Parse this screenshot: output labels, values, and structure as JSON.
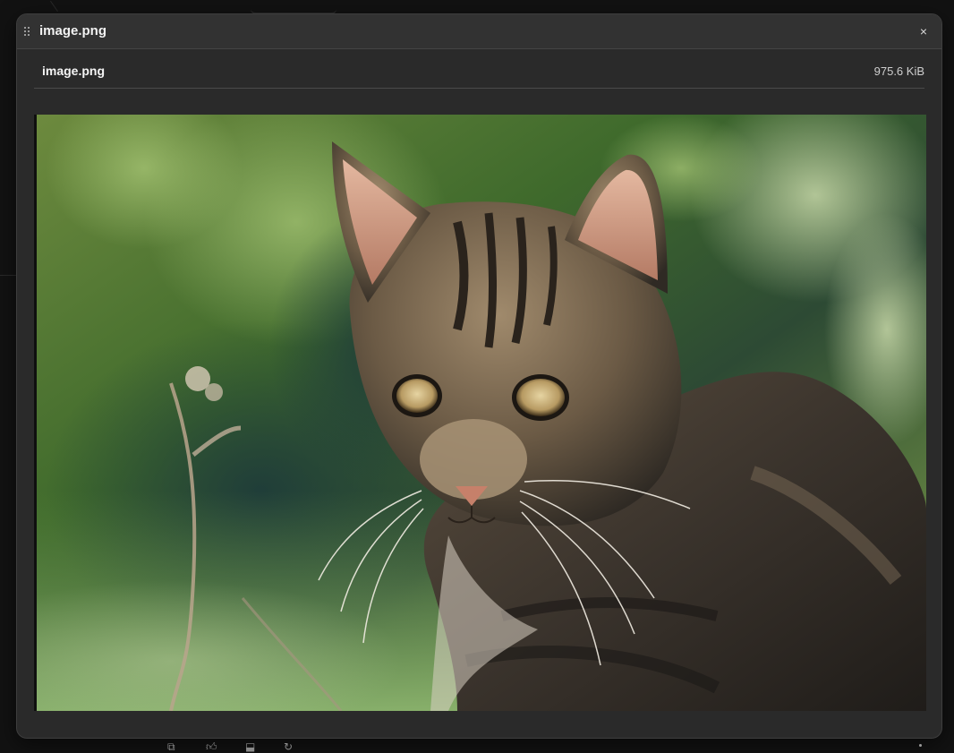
{
  "modal": {
    "title": "image.png",
    "close_label": "×"
  },
  "file": {
    "name": "image.png",
    "size": "975.6 KiB"
  },
  "preview": {
    "subject": "tabby cat photo"
  },
  "icons": {
    "drag": "drag-handle-icon",
    "close": "close-icon",
    "copy": "copy-icon",
    "thumbs_up": "thumbs-up-icon",
    "thumbs_down": "thumbs-down-icon",
    "regenerate": "regenerate-icon"
  }
}
